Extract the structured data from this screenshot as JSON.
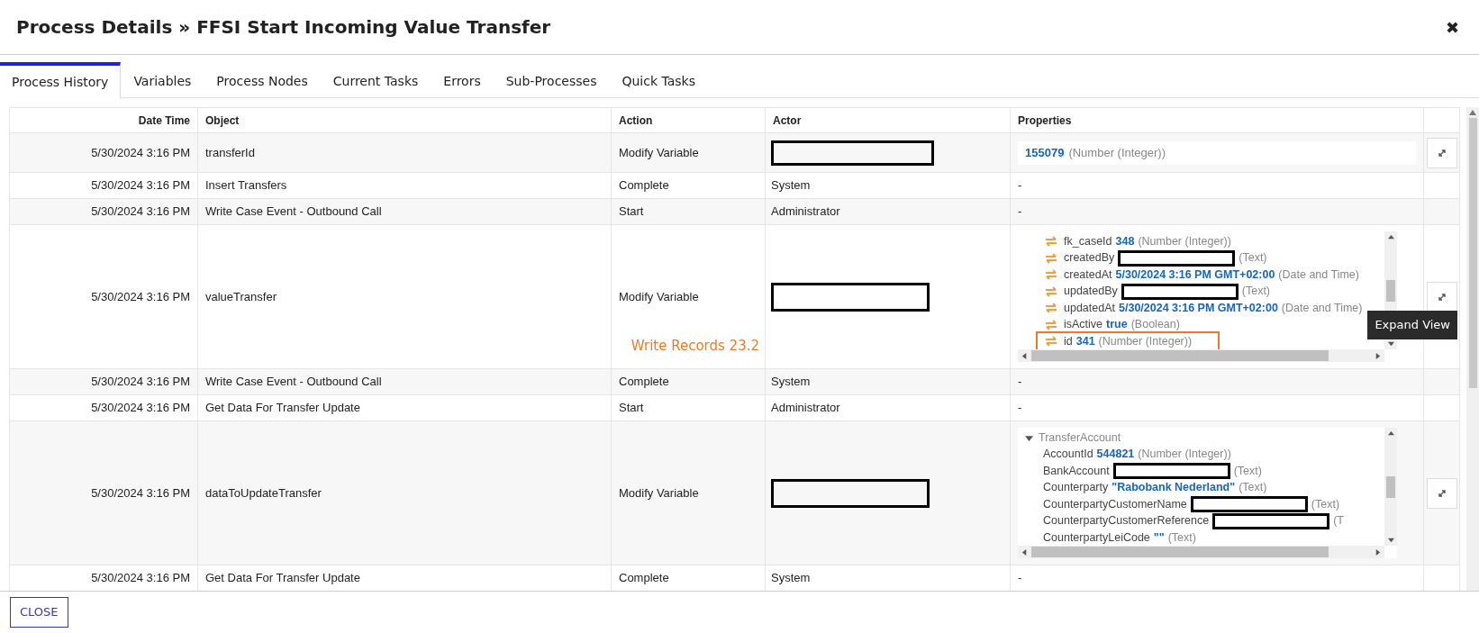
{
  "window": {
    "title": "Process Details » FFSI Start Incoming Value Transfer",
    "close_icon": "✖"
  },
  "tabs": [
    {
      "label": "Process History",
      "selected": true
    },
    {
      "label": "Variables",
      "selected": false
    },
    {
      "label": "Process Nodes",
      "selected": false
    },
    {
      "label": "Current Tasks",
      "selected": false
    },
    {
      "label": "Errors",
      "selected": false
    },
    {
      "label": "Sub-Processes",
      "selected": false
    },
    {
      "label": "Quick Tasks",
      "selected": false
    }
  ],
  "table": {
    "columns": [
      "Date Time",
      "Object",
      "Action",
      "Actor",
      "Properties"
    ],
    "rows": [
      {
        "date_time": "5/30/2024 3:16 PM",
        "object": "transferId",
        "action": "Modify Variable",
        "actor_redacted": true,
        "properties": {
          "kind": "value",
          "value": "155079",
          "type": "(Number (Integer))"
        },
        "expand_button": true
      },
      {
        "date_time": "5/30/2024 3:16 PM",
        "object": "Insert Transfers",
        "action": "Complete",
        "actor": "System",
        "properties": {
          "kind": "dash",
          "text": "-"
        },
        "expand_button": false
      },
      {
        "date_time": "5/30/2024 3:16 PM",
        "object": "Write Case Event - Outbound Call",
        "action": "Start",
        "actor": "Administrator",
        "properties": {
          "kind": "dash",
          "text": "-"
        },
        "expand_button": false
      },
      {
        "date_time": "5/30/2024 3:16 PM",
        "object": "valueTransfer",
        "action": "Modify Variable",
        "actor_redacted": true,
        "properties": {
          "kind": "tree",
          "lines": [
            {
              "name": "fk_caseId",
              "value": "348",
              "type": "(Number (Integer))"
            },
            {
              "name": "createdBy",
              "redacted": true,
              "type": "(Text)"
            },
            {
              "name": "createdAt",
              "value": "5/30/2024 3:16 PM GMT+02:00",
              "type": "(Date and Time)"
            },
            {
              "name": "updatedBy",
              "redacted": true,
              "type": "(Text)"
            },
            {
              "name": "updatedAt",
              "value": "5/30/2024 3:16 PM GMT+02:00",
              "type": "(Date and Time)"
            },
            {
              "name": "isActive",
              "value": "true",
              "type": "(Boolean)"
            },
            {
              "name": "id",
              "value": "341",
              "type": "(Number (Integer))",
              "highlighted": true
            }
          ]
        },
        "annotation": "Write Records 23.2",
        "expand_button": true,
        "tooltip": "Expand View"
      },
      {
        "date_time": "5/30/2024 3:16 PM",
        "object": "Write Case Event - Outbound Call",
        "action": "Complete",
        "actor": "System",
        "properties": {
          "kind": "dash",
          "text": "-"
        },
        "expand_button": false
      },
      {
        "date_time": "5/30/2024 3:16 PM",
        "object": "Get Data For Transfer Update",
        "action": "Start",
        "actor": "Administrator",
        "properties": {
          "kind": "dash",
          "text": "-"
        },
        "expand_button": false
      },
      {
        "date_time": "5/30/2024 3:16 PM",
        "object": "dataToUpdateTransfer",
        "action": "Modify Variable",
        "actor_redacted": true,
        "properties": {
          "kind": "tree",
          "group": "TransferAccount",
          "expanded": true,
          "lines": [
            {
              "name": "AccountId",
              "value": "544821",
              "type": "(Number (Integer))"
            },
            {
              "name": "BankAccount",
              "redacted": true,
              "type": "(Text)"
            },
            {
              "name": "Counterparty",
              "value": "\"Rabobank Nederland\"",
              "type": "(Text)"
            },
            {
              "name": "CounterpartyCustomerName",
              "redacted": true,
              "type": "(Text)"
            },
            {
              "name": "CounterpartyCustomerReference",
              "redacted": true,
              "type": "(T"
            },
            {
              "name": "CounterpartyLeiCode",
              "value": "\"\"",
              "type": "(Text)"
            }
          ]
        },
        "expand_button": true
      },
      {
        "date_time": "5/30/2024 3:16 PM",
        "object": "Get Data For Transfer Update",
        "action": "Complete",
        "actor": "System",
        "properties": {
          "kind": "dash",
          "text": "-"
        },
        "expand_button": false
      }
    ]
  },
  "footer": {
    "button": "CLOSE"
  }
}
